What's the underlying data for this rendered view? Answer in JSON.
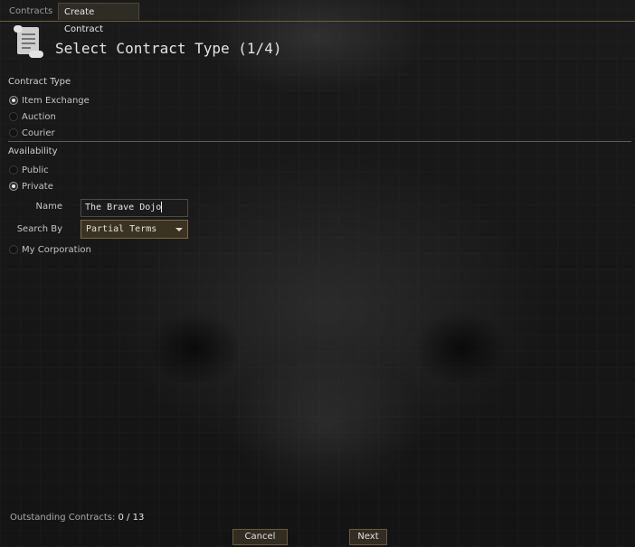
{
  "tabs": [
    {
      "label": "Contracts"
    },
    {
      "label": "Create Contract"
    }
  ],
  "header": {
    "title": "Select Contract Type (1/4)",
    "icon": "scroll-icon"
  },
  "contract_type": {
    "label": "Contract Type",
    "options": [
      {
        "label": "Item Exchange",
        "selected": true
      },
      {
        "label": "Auction",
        "selected": false
      },
      {
        "label": "Courier",
        "selected": false
      }
    ]
  },
  "availability": {
    "label": "Availability",
    "options": [
      {
        "label": "Public",
        "selected": false
      },
      {
        "label": "Private",
        "selected": true
      },
      {
        "label": "My Corporation",
        "selected": false
      }
    ],
    "name_label": "Name",
    "name_value": "The Brave Dojo",
    "search_label": "Search By",
    "search_value": "Partial Terms"
  },
  "footer": {
    "outstanding_label": "Outstanding Contracts:",
    "outstanding_value": "0 / 13",
    "cancel_label": "Cancel",
    "next_label": "Next"
  },
  "colors": {
    "accent": "#6d5e3e",
    "button_bg": "#332d20"
  }
}
